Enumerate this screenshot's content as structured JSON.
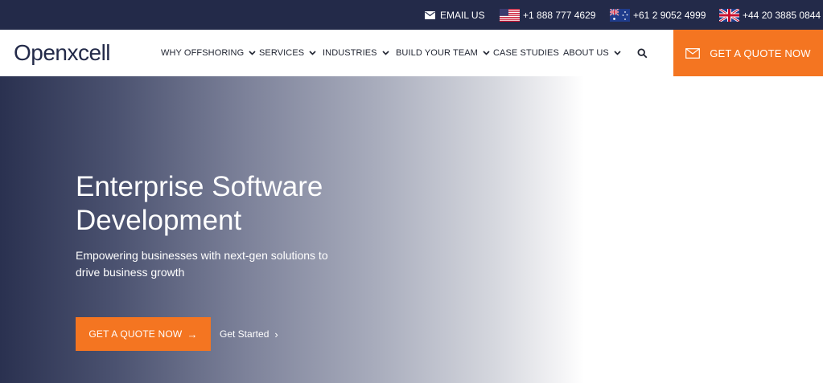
{
  "topbar": {
    "email_label": "EMAIL US",
    "us_phone": "+1 888 777 4629",
    "au_phone": "+61 2 9052 4999",
    "uk_phone": "+44 20 3885 0844"
  },
  "header": {
    "logo": "Openxcell",
    "nav": [
      {
        "label": "WHY OFFSHORING",
        "dropdown": true
      },
      {
        "label": "SERVICES",
        "dropdown": true
      },
      {
        "label": "INDUSTRIES",
        "dropdown": true
      },
      {
        "label": "BUILD YOUR TEAM",
        "dropdown": true
      },
      {
        "label": "CASE STUDIES",
        "dropdown": false
      },
      {
        "label": "ABOUT US",
        "dropdown": true
      }
    ],
    "quote_button": "GET A QUOTE NOW"
  },
  "hero": {
    "title": "Enterprise Software Development",
    "subtitle": "Empowering businesses with next-gen solutions to drive business growth",
    "cta_primary": "GET A QUOTE NOW",
    "cta_primary_arrow": "→",
    "cta_secondary": "Get Started",
    "cta_secondary_chevron": "›"
  },
  "colors": {
    "navy": "#232a49",
    "accent": "#f47521",
    "white": "#ffffff"
  },
  "icons": [
    "mail-icon",
    "us-flag-icon",
    "au-flag-icon",
    "uk-flag-icon",
    "chevron-down-icon",
    "search-icon",
    "arrow-right-icon",
    "chevron-right-icon"
  ]
}
